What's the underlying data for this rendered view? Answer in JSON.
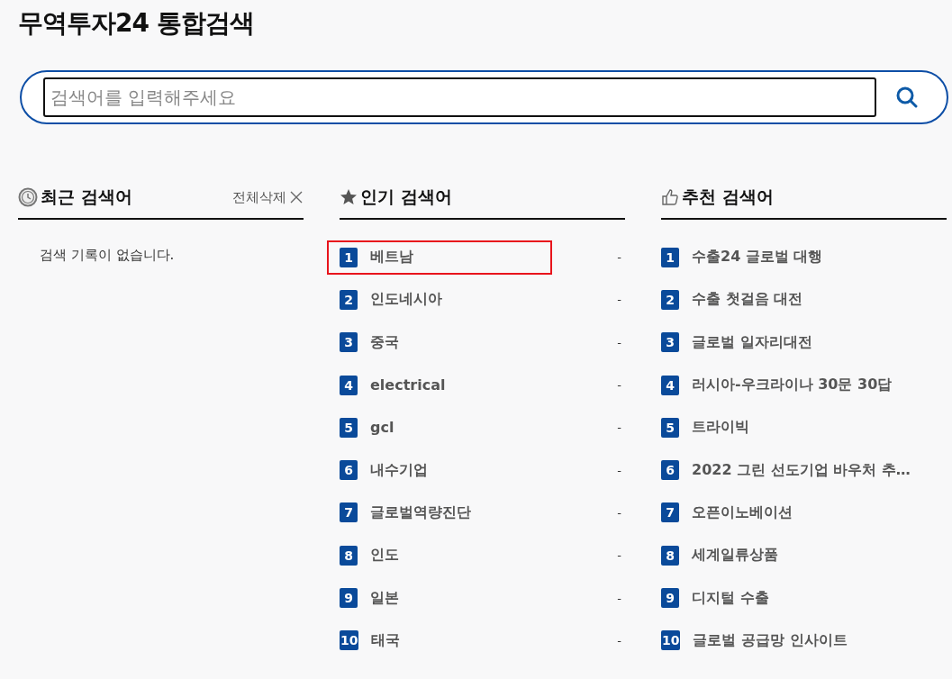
{
  "title": "무역투자24 통합검색",
  "search": {
    "placeholder": "검색어를 입력해주세요"
  },
  "recent": {
    "title": "최근 검색어",
    "clear_label": "전체삭제",
    "empty_message": "검색 기록이 없습니다."
  },
  "popular": {
    "title": "인기 검색어",
    "items": [
      {
        "rank": "1",
        "label": "베트남",
        "trend": "-",
        "highlighted": true
      },
      {
        "rank": "2",
        "label": "인도네시아",
        "trend": "-",
        "highlighted": false
      },
      {
        "rank": "3",
        "label": "중국",
        "trend": "-",
        "highlighted": false
      },
      {
        "rank": "4",
        "label": "electrical",
        "trend": "-",
        "highlighted": false
      },
      {
        "rank": "5",
        "label": "gcl",
        "trend": "-",
        "highlighted": false
      },
      {
        "rank": "6",
        "label": "내수기업",
        "trend": "-",
        "highlighted": false
      },
      {
        "rank": "7",
        "label": "글로벌역량진단",
        "trend": "-",
        "highlighted": false
      },
      {
        "rank": "8",
        "label": "인도",
        "trend": "-",
        "highlighted": false
      },
      {
        "rank": "9",
        "label": "일본",
        "trend": "-",
        "highlighted": false
      },
      {
        "rank": "10",
        "label": "태국",
        "trend": "-",
        "highlighted": false
      }
    ]
  },
  "recommended": {
    "title": "추천 검색어",
    "items": [
      {
        "rank": "1",
        "label": "수출24 글로벌 대행"
      },
      {
        "rank": "2",
        "label": "수출 첫걸음 대전"
      },
      {
        "rank": "3",
        "label": "글로벌 일자리대전"
      },
      {
        "rank": "4",
        "label": "러시아-우크라이나 30문 30답"
      },
      {
        "rank": "5",
        "label": "트라이빅"
      },
      {
        "rank": "6",
        "label": "2022 그린 선도기업 바우처 추…"
      },
      {
        "rank": "7",
        "label": "오픈이노베이션"
      },
      {
        "rank": "8",
        "label": "세계일류상품"
      },
      {
        "rank": "9",
        "label": "디지털 수출"
      },
      {
        "rank": "10",
        "label": "글로벌 공급망 인사이트"
      }
    ]
  }
}
